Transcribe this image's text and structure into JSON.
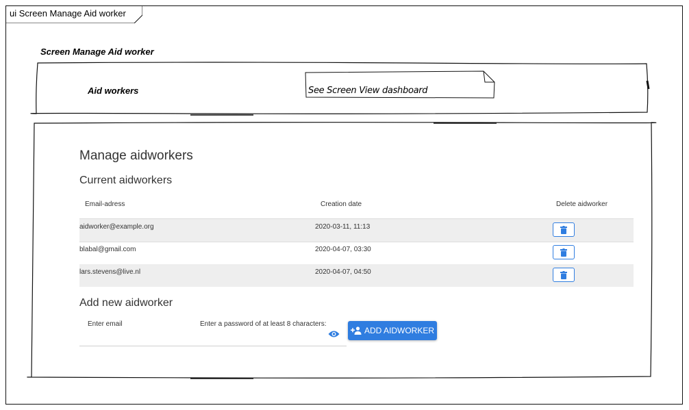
{
  "frame": {
    "title": "ui Screen Manage Aid worker"
  },
  "screen_title": "Screen Manage Aid worker",
  "header": {
    "label": "Aid workers",
    "note": "See Screen  View dashboard"
  },
  "main": {
    "title": "Manage aidworkers",
    "current_title": "Current aidworkers",
    "columns": [
      "Email-adress",
      "Creation date",
      "Delete aidworker"
    ],
    "rows": [
      {
        "email": "aidworker@example.org",
        "date": "2020-03-11, 11:13"
      },
      {
        "email": "blabal@gmail.com",
        "date": "2020-04-07, 03:30"
      },
      {
        "email": "lars.stevens@live.nl",
        "date": "2020-04-07, 04:50"
      }
    ],
    "add_title": "Add new aidworker",
    "email_label": "Enter email",
    "password_label": "Enter a password of at least 8 characters:",
    "add_button": "ADD AIDWORKER"
  },
  "colors": {
    "accent": "#2f7de0",
    "row_shade": "#eeeeee"
  },
  "icons": [
    "trash-icon",
    "eye-icon",
    "person-add-icon"
  ]
}
